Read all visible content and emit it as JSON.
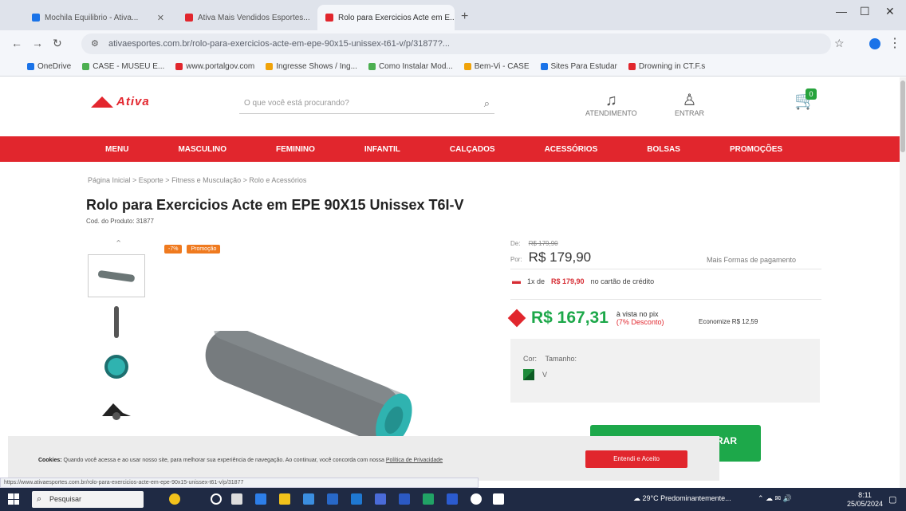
{
  "browser": {
    "tabs": [
      {
        "label": "Mochila Equilibrio - Ativa...",
        "color": "#1a73e8"
      },
      {
        "label": "Ativa Mais Vendidos Esportes...",
        "color": "#e1262d"
      },
      {
        "label": "Rolo para Exercicios Acte em E...",
        "color": "#e1262d"
      }
    ],
    "url": "ativaesportes.com.br/rolo-para-exercicios-acte-em-epe-90x15-unissex-t61-v/p/31877?...",
    "bookmarks": [
      {
        "label": "OneDrive",
        "color": "#1a73e8"
      },
      {
        "label": "CASE - MUSEU E...",
        "color": "#4caf50"
      },
      {
        "label": "www.portalgov.com",
        "color": "#e1262d"
      },
      {
        "label": "Ingresse Shows / Ing...",
        "color": "#f0a30a"
      },
      {
        "label": "Como Instalar Mod...",
        "color": "#4caf50"
      },
      {
        "label": "Bem-Vi - CASE",
        "color": "#f0a30a"
      },
      {
        "label": "Sites Para Estudar",
        "color": "#1a73e8"
      },
      {
        "label": "Drowning in CT.F.s",
        "color": "#e1262d"
      }
    ]
  },
  "header": {
    "logo_text": "Ativa",
    "search_placeholder": "O que você está procurando?",
    "atendimento": "ATENDIMENTO",
    "entrar": "ENTRAR",
    "cart_count": "0"
  },
  "nav": [
    "MENU",
    "MASCULINO",
    "FEMININO",
    "INFANTIL",
    "CALÇADOS",
    "ACESSÓRIOS",
    "BOLSAS",
    "PROMOÇÕES"
  ],
  "product": {
    "breadcrumb": "Página Inicial > Esporte > Fitness e Musculação > Rolo e Acessórios",
    "title": "Rolo para Exercicios Acte em EPE 90X15 Unissex T6I-V",
    "code": "Cod. do Produto: 31877",
    "tags": [
      "-7%",
      "Promoção"
    ],
    "price_old_label": "De:",
    "price_old": "R$ 179,90",
    "price_label": "Por:",
    "price": "R$ 179,90",
    "payment_options": "Mais Formas de pagamento",
    "installment_prefix": "1x de",
    "installment_value": "R$ 179,90",
    "installment_suffix": "no cartão de crédito",
    "pix_price": "R$ 167,31",
    "pix_label": "à vista no pix",
    "pix_discount": "(7% Desconto)",
    "economize": "Economize R$ 12,59",
    "color_label": "Cor:",
    "size_label": "Tamanho:",
    "size_value": "V",
    "buy_button": "COMPRAR"
  },
  "cookie": {
    "title": "Cookies:",
    "text": "Quando você acessa e ao usar nosso site, para melhorar sua experiência de navegação. Ao continuar, você concorda com nossa",
    "link": "Política de Privacidade",
    "accept": "Entendi e Aceito"
  },
  "status_url": "https://www.ativaesportes.com.br/rolo-para-exercicios-acte-em-epe-90x15-unissex-t61-v/p/31877",
  "taskbar": {
    "search": "Pesquisar",
    "weather": "29°C Predominantemente...",
    "time": "8:11",
    "date": "25/05/2024"
  }
}
